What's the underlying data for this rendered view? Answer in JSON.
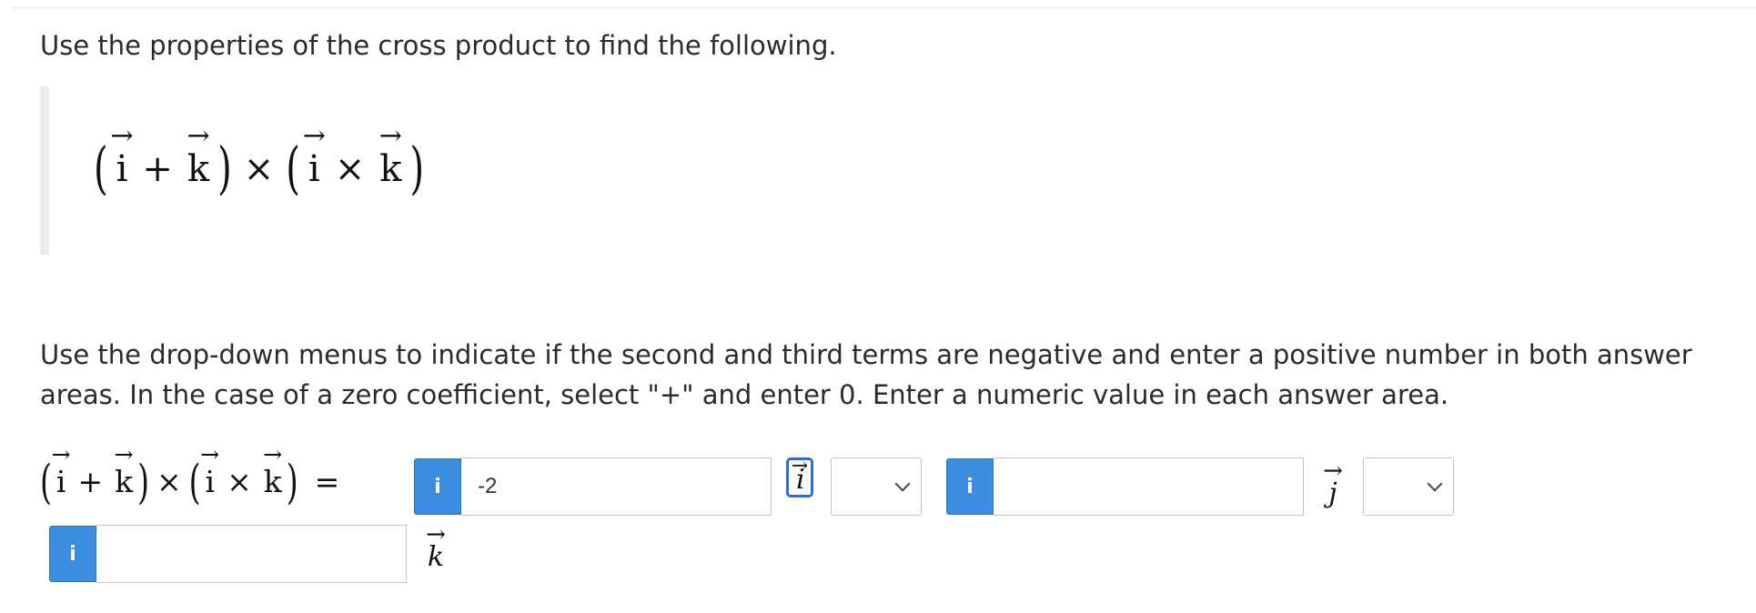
{
  "instructions": {
    "line1": "Use the properties of the cross product to find the following.",
    "line2": "Use the drop-down menus to indicate if the second and third terms are negative and enter a positive number in both answer areas. In the case of a zero coefficient, select \"+\" and enter 0. Enter a numeric value in each answer area."
  },
  "expression": {
    "open": "(",
    "close": ")",
    "i": "i",
    "k": "k",
    "arrow": "→",
    "plus": "+",
    "times": "×",
    "equals": "="
  },
  "answer": {
    "info_label": "i",
    "term1": {
      "value": "-2",
      "unit": "i"
    },
    "term2": {
      "sign": "",
      "value": "",
      "unit": "j"
    },
    "term3": {
      "sign": "",
      "value": "",
      "unit": "k"
    }
  },
  "colors": {
    "info_button": "#3b8de0",
    "focus_ring": "#2f6bd6"
  }
}
